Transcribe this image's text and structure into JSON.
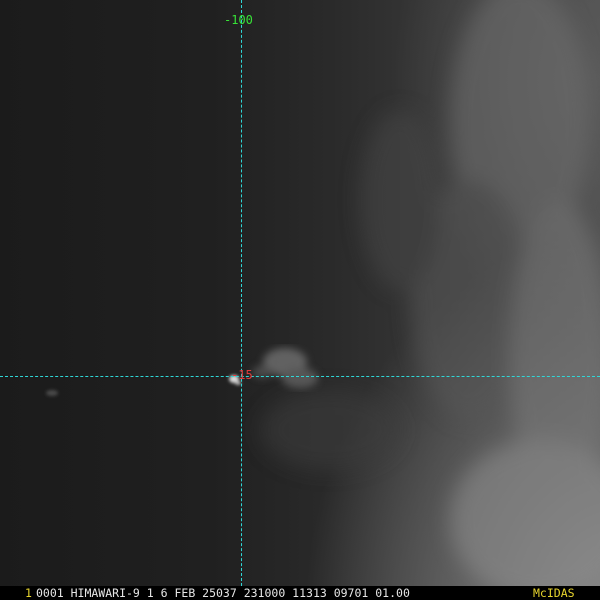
{
  "image": {
    "grid": {
      "longitude_label": "-100",
      "latitude_label": "-15",
      "line_color": "#2fd7d7"
    },
    "status_bar": {
      "frame_number": "1",
      "header": "0001 HIMAWARI-9  1  6 FEB 25037 231000 11313 09701 01.00",
      "brand": "McIDAS"
    },
    "colors": {
      "longitude_label": "#37e337",
      "latitude_label": "#e23b3b",
      "frame_number": "#e8d52e",
      "brand": "#e8d52e",
      "header_text": "#e6e6e6"
    }
  }
}
